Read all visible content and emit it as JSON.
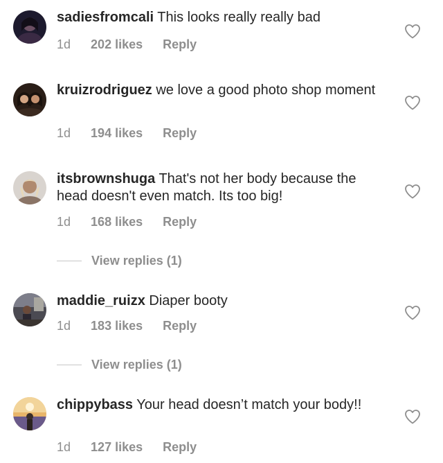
{
  "comments": [
    {
      "username": "sadiesfromcali",
      "text": "This looks really really bad",
      "time": "1d",
      "likes": "202 likes",
      "reply": "Reply",
      "avatar_icon": "profile-photo"
    },
    {
      "username": "kruizrodriguez",
      "text": "we love a good photo shop moment",
      "time": "1d",
      "likes": "194 likes",
      "reply": "Reply",
      "avatar_icon": "profile-photo"
    },
    {
      "username": "itsbrownshuga",
      "text": "That's not her body because the head doesn't even match.  Its too big!",
      "time": "1d",
      "likes": "168 likes",
      "reply": "Reply",
      "view_replies": "View replies (1)",
      "avatar_icon": "profile-photo"
    },
    {
      "username": "maddie_ruizx",
      "text": "Diaper booty",
      "time": "1d",
      "likes": "183 likes",
      "reply": "Reply",
      "view_replies": "View replies (1)",
      "avatar_icon": "profile-photo"
    },
    {
      "username": "chippybass",
      "text": "Your head doesn’t match your body!!",
      "time": "1d",
      "likes": "127 likes",
      "reply": "Reply",
      "avatar_icon": "profile-photo"
    }
  ],
  "colors": {
    "text": "#262626",
    "secondary": "#8e8e8e",
    "divider": "#c7c7c7",
    "heart_outline": "#8e8e8e"
  },
  "icons": {
    "like": "heart-outline-icon"
  }
}
